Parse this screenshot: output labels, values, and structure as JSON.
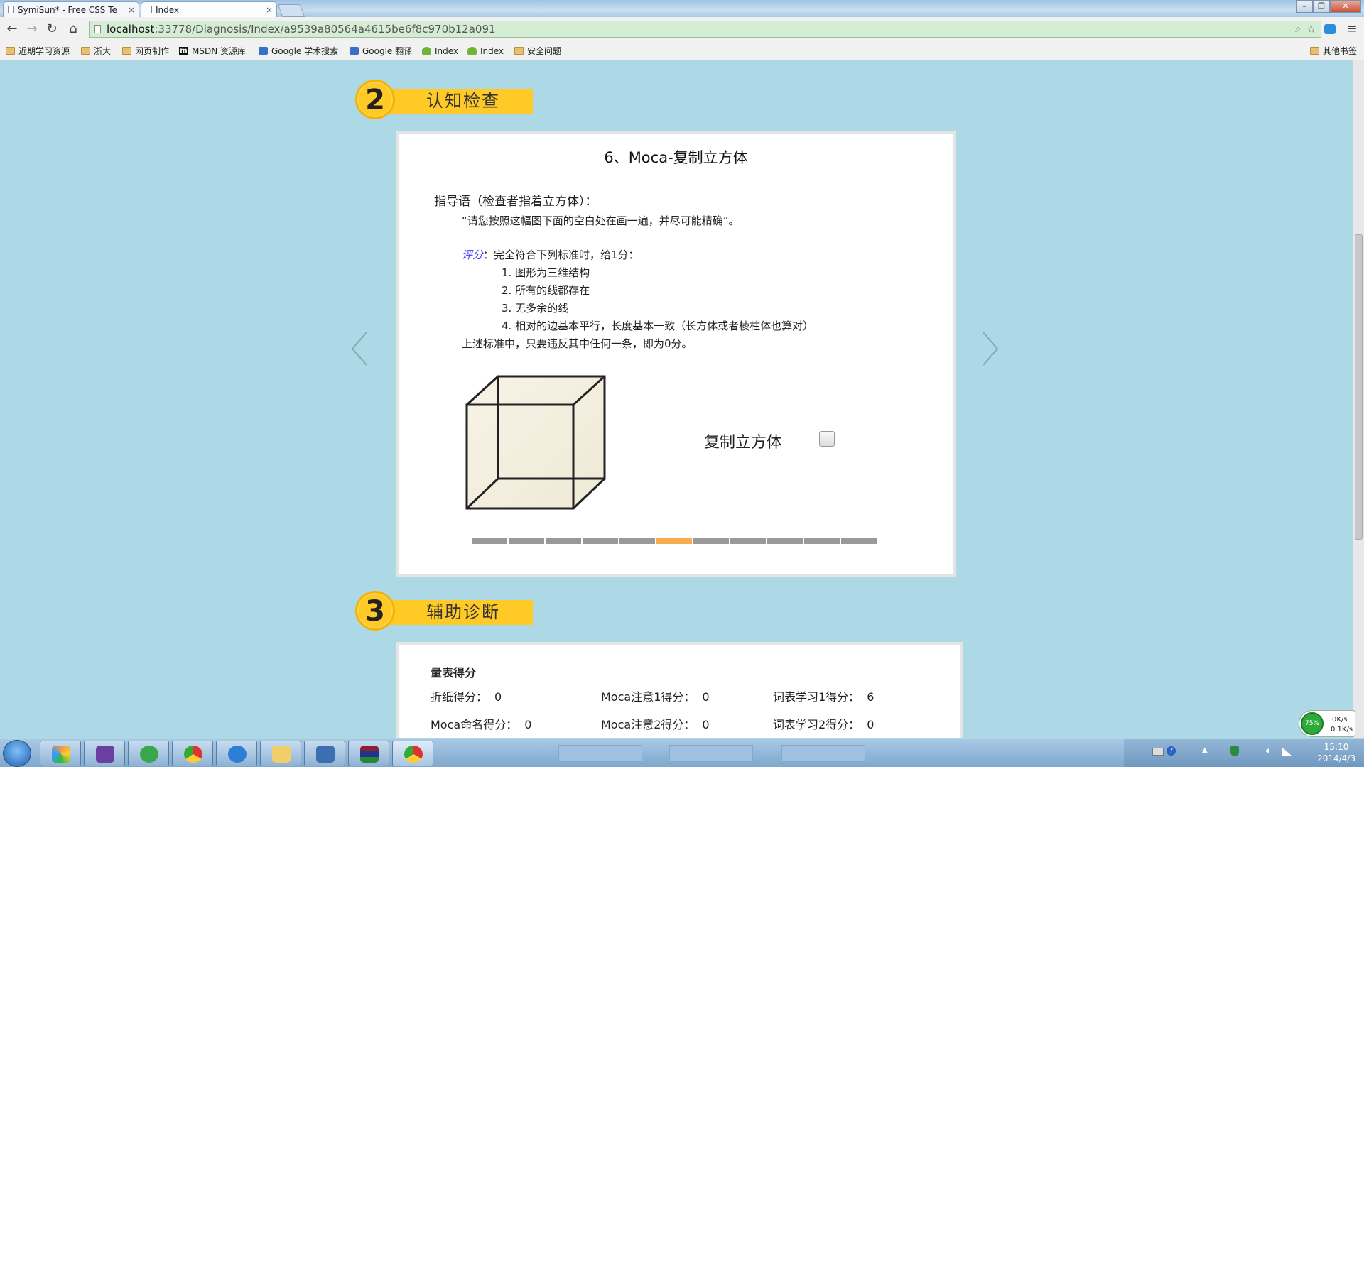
{
  "browser": {
    "tabs": [
      {
        "label": "SymiSun* - Free CSS Te"
      },
      {
        "label": "Index"
      }
    ],
    "address": {
      "host": "localhost",
      "path": ":33778/Diagnosis/Index/a9539a80564a4615be6f8c970b12a091"
    },
    "bookmarks": [
      {
        "label": "近期学习资源",
        "icon": "folder-icon"
      },
      {
        "label": "浙大",
        "icon": "folder-icon"
      },
      {
        "label": "网页制作",
        "icon": "folder-icon"
      },
      {
        "label": "MSDN 资源库",
        "icon": "msdn-icon"
      },
      {
        "label": "Google 学术搜索",
        "icon": "google-scholar-icon"
      },
      {
        "label": "Google 翻译",
        "icon": "google-translate-icon"
      },
      {
        "label": "Index",
        "icon": "leaf-icon"
      },
      {
        "label": "Index",
        "icon": "leaf-icon"
      },
      {
        "label": "安全问题",
        "icon": "folder-icon"
      }
    ],
    "other_bookmarks": "其他书签"
  },
  "section2": {
    "number": "2",
    "title": "认知检查"
  },
  "question": {
    "title": "6、Moca-复制立方体",
    "instruction_label": "指导语（检查者指着立方体）：",
    "instruction_text": "“请您按照这幅图下面的空白处在画一遍，并尽可能精确”。",
    "scoring_label": "评分",
    "scoring_text": "：完全符合下列标准时，给1分：",
    "criteria": [
      {
        "num": "1.",
        "text": "图形为三维结构"
      },
      {
        "num": "2.",
        "text": "所有的线都存在"
      },
      {
        "num": "3.",
        "text": "无多余的线"
      },
      {
        "num": "4.",
        "text": "相对的边基本平行，长度基本一致（长方体或者棱柱体也算对）"
      }
    ],
    "fail_rule": "上述标准中，只要违反其中任何一条，即为0分。",
    "checkbox_label": "复制立方体",
    "checkbox_checked": false,
    "progress": {
      "total": 11,
      "current": 6
    }
  },
  "section3": {
    "number": "3",
    "title": "辅助诊断"
  },
  "scores": {
    "heading": "量表得分",
    "rows": [
      [
        {
          "label": "折纸得分：",
          "value": "0"
        },
        {
          "label": "Moca注意1得分：",
          "value": "0"
        },
        {
          "label": "词表学习1得分：",
          "value": "6"
        }
      ],
      [
        {
          "label": "Moca命名得分：",
          "value": "0"
        },
        {
          "label": "Moca注意2得分：",
          "value": "0"
        },
        {
          "label": "词表学习2得分：",
          "value": "0"
        }
      ]
    ]
  },
  "taskbar": {
    "clock_time": "15:10",
    "clock_date": "2014/4/3",
    "net_percent": "75%",
    "net_up": "0K/s",
    "net_down": "0.1K/s"
  },
  "colors": {
    "accent": "#ffc926",
    "progress_active": "#f7ad4f",
    "progress_idle": "#999999",
    "page_bg": "#add8e6",
    "scoring_label": "#3a3aff"
  }
}
